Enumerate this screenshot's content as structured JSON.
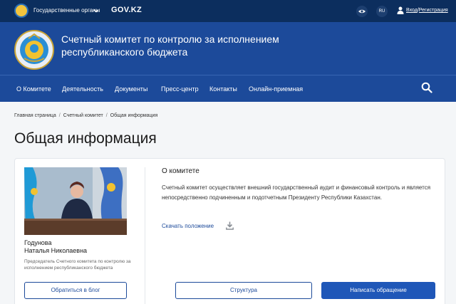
{
  "topbar": {
    "gov_menu_label": "Государственные органы",
    "portal_label": "GOV.KZ",
    "lang_label": "RU",
    "login_label": "Вход",
    "login_separator": "/",
    "register_label": "Регистрация"
  },
  "header": {
    "org_name": "Счетный комитет по контролю за исполнением республиканского бюджета"
  },
  "nav": {
    "items": [
      {
        "label": "О Комитете"
      },
      {
        "label": "Деятельность"
      },
      {
        "label": "Документы"
      },
      {
        "label": "Пресс-центр"
      },
      {
        "label": "Контакты"
      },
      {
        "label": "Онлайн-приемная"
      }
    ]
  },
  "breadcrumb": {
    "items": [
      "Главная страница",
      "Счетный комитет",
      "Общая информация"
    ],
    "separator": "/"
  },
  "page": {
    "title": "Общая информация"
  },
  "leader": {
    "name_line1": "Годунова",
    "name_line2": "Наталья Николаевна",
    "role": "Председатель Счетного комитета по контролю за исполнением республиканского бюджета",
    "blog_button": "Обратиться в блог"
  },
  "about": {
    "heading": "О комитете",
    "text": "Счетный комитет осуществляет внешний государственный аудит и финансовый контроль и является непосредственно подчиненным и подотчетным Президенту Республики Казахстан.",
    "download_label": "Скачать положение"
  },
  "actions": {
    "structure_button": "Структура",
    "appeal_button": "Написать обращение"
  },
  "icons": {
    "eye": "eye-icon",
    "user": "user-icon",
    "search": "search-icon",
    "download": "download-icon",
    "chevron": "chevron-down-icon"
  },
  "colors": {
    "topbar": "#0c2e5e",
    "brand_blue": "#1c4a9a",
    "button_blue": "#1f57b8",
    "page_bg": "#f4f6f8"
  }
}
